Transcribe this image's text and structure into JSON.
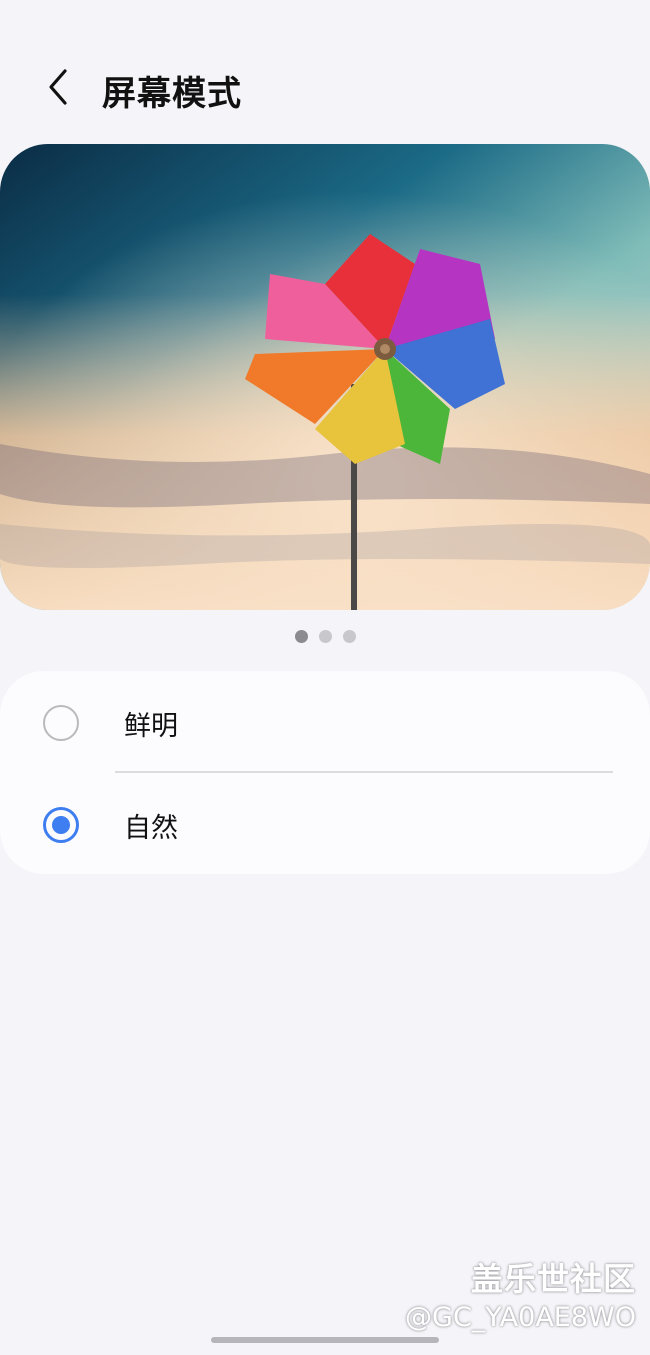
{
  "header": {
    "title": "屏幕模式",
    "back_icon": "chevron-left-icon"
  },
  "preview": {
    "description_icon": "pinwheel-image",
    "page_count": 3,
    "active_page": 1
  },
  "options": [
    {
      "label": "鲜明",
      "selected": false
    },
    {
      "label": "自然",
      "selected": true
    }
  ],
  "watermark": {
    "line1": "盖乐世社区",
    "line2": "@GC_YA0AE8WO"
  },
  "colors": {
    "accent": "#3e7ef0",
    "background": "#f5f5f9",
    "card": "#fcfcfe"
  }
}
